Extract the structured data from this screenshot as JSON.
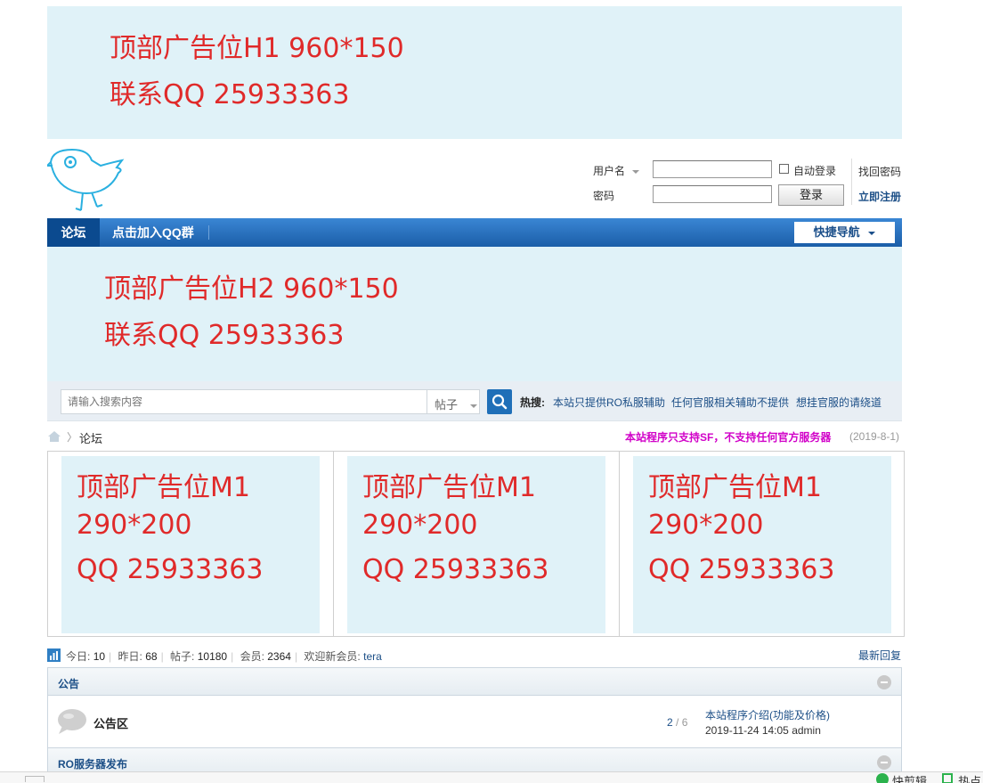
{
  "ads": {
    "h1": {
      "line1": "顶部广告位H1 960*150",
      "line2": "联系QQ 25933363"
    },
    "h2": {
      "line1": "顶部广告位H2  960*150",
      "line2": "联系QQ 25933363"
    },
    "m1": [
      {
        "line1": "顶部广告位M1",
        "line2": "290*200",
        "line3": "QQ 25933363"
      },
      {
        "line1": "顶部广告位M1",
        "line2": "290*200",
        "line3": "QQ 25933363"
      },
      {
        "line1": "顶部广告位M1",
        "line2": "290*200",
        "line3": "QQ 25933363"
      }
    ]
  },
  "login": {
    "username_label": "用户名",
    "password_label": "密码",
    "auto_login_label": "自动登录",
    "login_button": "登录",
    "forgot_password": "找回密码",
    "register": "立即注册"
  },
  "nav": {
    "home": "论坛",
    "items": [
      "点击加入QQ群"
    ],
    "quick_nav": "快捷导航"
  },
  "search": {
    "placeholder": "请输入搜索内容",
    "type": "帖子",
    "hot_label": "热搜:",
    "hot_links": [
      "本站只提供RO私服辅助",
      "任何官服相关辅助不提供",
      "想挂官服的请绕道"
    ]
  },
  "breadcrumb": {
    "current": "论坛"
  },
  "site_notice": {
    "text": "本站程序只支持SF，不支持任何官方服务器",
    "date": "(2019-8-1)"
  },
  "stats": {
    "today_label": "今日:",
    "today": "10",
    "yesterday_label": "昨日:",
    "yesterday": "68",
    "posts_label": "帖子:",
    "posts": "10180",
    "members_label": "会员:",
    "members": "2364",
    "newest_label": "欢迎新会员:",
    "newest_member": "tera",
    "latest_reply": "最新回复"
  },
  "categories": [
    {
      "title": "公告",
      "forums": [
        {
          "name": "公告区",
          "threads": "2",
          "posts": "6",
          "last_title": "本站程序介绍(功能及价格)",
          "last_time": "2019-11-24 14:05",
          "last_user": "admin"
        }
      ]
    },
    {
      "title": "RO服务器发布",
      "forums": []
    }
  ],
  "bottom_tabs": [
    "快剪辑",
    "热点"
  ],
  "colors": {
    "ad_bg": "#e0f2f8",
    "ad_text": "#e02a2a",
    "nav_blue": "#1b5ea8",
    "nav_dark": "#0b4a8f",
    "link": "#1c4f87",
    "notice": "#d100c8"
  }
}
